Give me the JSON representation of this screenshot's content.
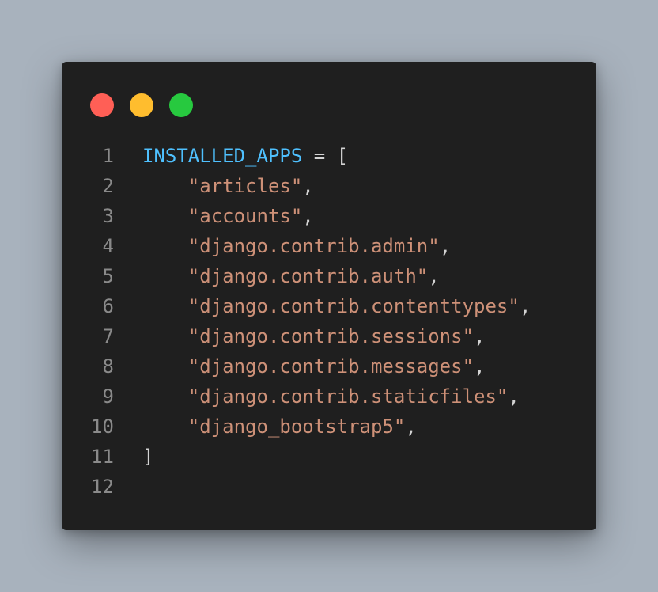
{
  "colors": {
    "background": "#a8b2bd",
    "window_bg": "#1f1f1f",
    "close": "#ff5f56",
    "minimize": "#ffbd2e",
    "maximize": "#27c93f",
    "line_number": "#8a8a8a",
    "identifier": "#4fc1ff",
    "string": "#ce9178",
    "punctuation": "#d4d4d4"
  },
  "editor": {
    "lines": [
      {
        "num": "1",
        "tokens": [
          {
            "t": "INSTALLED_APPS",
            "k": "ident"
          },
          {
            "t": " = [",
            "k": "punct"
          }
        ]
      },
      {
        "num": "2",
        "tokens": [
          {
            "t": "    ",
            "k": "punct"
          },
          {
            "t": "\"articles\"",
            "k": "str"
          },
          {
            "t": ",",
            "k": "punct"
          }
        ]
      },
      {
        "num": "3",
        "tokens": [
          {
            "t": "    ",
            "k": "punct"
          },
          {
            "t": "\"accounts\"",
            "k": "str"
          },
          {
            "t": ",",
            "k": "punct"
          }
        ]
      },
      {
        "num": "4",
        "tokens": [
          {
            "t": "    ",
            "k": "punct"
          },
          {
            "t": "\"django.contrib.admin\"",
            "k": "str"
          },
          {
            "t": ",",
            "k": "punct"
          }
        ]
      },
      {
        "num": "5",
        "tokens": [
          {
            "t": "    ",
            "k": "punct"
          },
          {
            "t": "\"django.contrib.auth\"",
            "k": "str"
          },
          {
            "t": ",",
            "k": "punct"
          }
        ]
      },
      {
        "num": "6",
        "tokens": [
          {
            "t": "    ",
            "k": "punct"
          },
          {
            "t": "\"django.contrib.contenttypes\"",
            "k": "str"
          },
          {
            "t": ",",
            "k": "punct"
          }
        ]
      },
      {
        "num": "7",
        "tokens": [
          {
            "t": "    ",
            "k": "punct"
          },
          {
            "t": "\"django.contrib.sessions\"",
            "k": "str"
          },
          {
            "t": ",",
            "k": "punct"
          }
        ]
      },
      {
        "num": "8",
        "tokens": [
          {
            "t": "    ",
            "k": "punct"
          },
          {
            "t": "\"django.contrib.messages\"",
            "k": "str"
          },
          {
            "t": ",",
            "k": "punct"
          }
        ]
      },
      {
        "num": "9",
        "tokens": [
          {
            "t": "    ",
            "k": "punct"
          },
          {
            "t": "\"django.contrib.staticfiles\"",
            "k": "str"
          },
          {
            "t": ",",
            "k": "punct"
          }
        ]
      },
      {
        "num": "10",
        "tokens": [
          {
            "t": "    ",
            "k": "punct"
          },
          {
            "t": "\"django_bootstrap5\"",
            "k": "str"
          },
          {
            "t": ",",
            "k": "punct"
          }
        ]
      },
      {
        "num": "11",
        "tokens": [
          {
            "t": "]",
            "k": "punct"
          }
        ]
      },
      {
        "num": "12",
        "tokens": []
      }
    ]
  }
}
